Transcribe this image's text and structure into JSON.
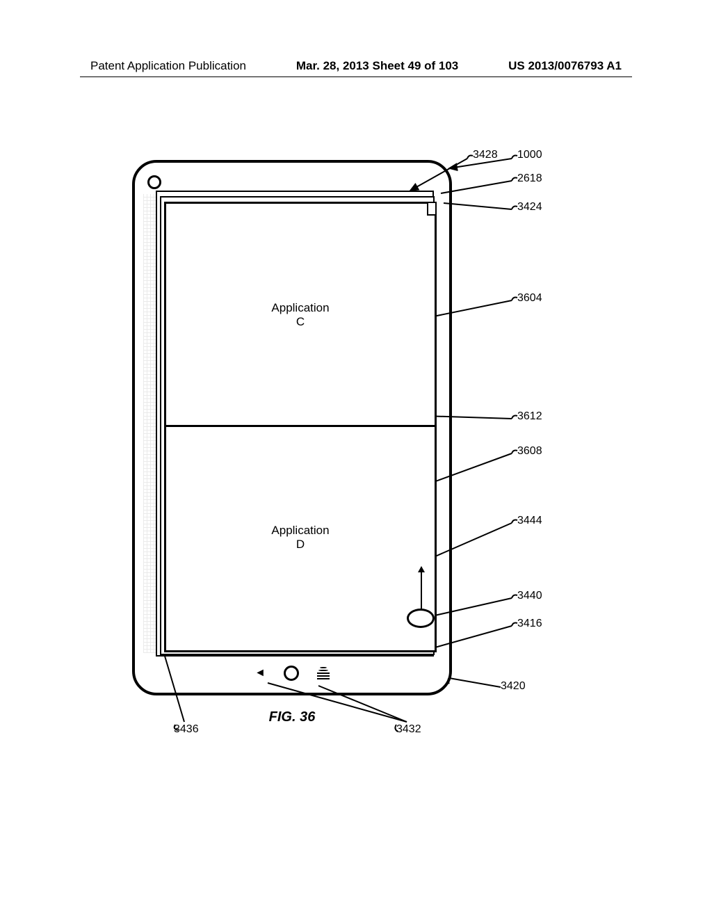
{
  "header": {
    "left": "Patent Application Publication",
    "mid": "Mar. 28, 2013  Sheet 49 of 103",
    "right": "US 2013/0076793 A1"
  },
  "app_c_line1": "Application",
  "app_c_line2": "C",
  "app_d_line1": "Application",
  "app_d_line2": "D",
  "labels": {
    "l3428": "3428",
    "l1000": "1000",
    "l2618": "2618",
    "l3424": "3424",
    "l3604": "3604",
    "l3612": "3612",
    "l3608": "3608",
    "l3444": "3444",
    "l3440": "3440",
    "l3416": "3416",
    "l3420": "3420",
    "l3432": "3432",
    "l3436": "3436"
  },
  "figcap": "FIG. 36"
}
